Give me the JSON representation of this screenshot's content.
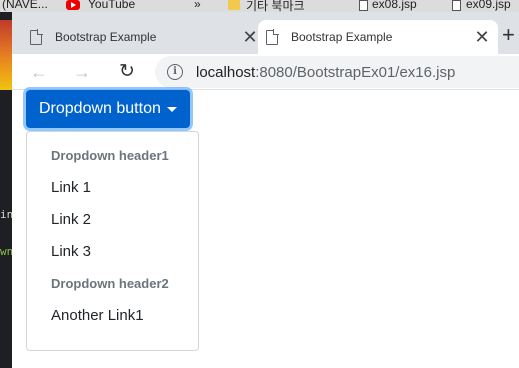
{
  "behind": {
    "items": [
      "(NAVE...",
      "YouTube",
      "기타 북마크",
      "ex08.jsp",
      "ex09.jsp"
    ],
    "more_glyph": "»"
  },
  "background_editor": {
    "line1": "in",
    "line2": "wn"
  },
  "tabs": [
    {
      "title": "Bootstrap Example",
      "active": false,
      "close_glyph": "✕"
    },
    {
      "title": "Bootstrap Example",
      "active": true,
      "close_glyph": "✕"
    }
  ],
  "new_tab_glyph": "+",
  "toolbar": {
    "back_glyph": "←",
    "forward_glyph": "→",
    "reload_glyph": "↻",
    "info_glyph": "i",
    "url_host": "localhost",
    "url_rest": ":8080/BootstrapEx01/ex16.jsp"
  },
  "dropdown": {
    "button_label": "Dropdown button",
    "items": [
      {
        "kind": "header",
        "text": "Dropdown header1"
      },
      {
        "kind": "link",
        "text": "Link 1"
      },
      {
        "kind": "link",
        "text": "Link 2"
      },
      {
        "kind": "link",
        "text": "Link 3"
      },
      {
        "kind": "header",
        "text": "Dropdown header2"
      },
      {
        "kind": "link",
        "text": "Another Link1"
      }
    ]
  },
  "colors": {
    "primary_button": "#0062cc",
    "header_text": "#6c757d",
    "tab_strip": "#dee1e6"
  }
}
